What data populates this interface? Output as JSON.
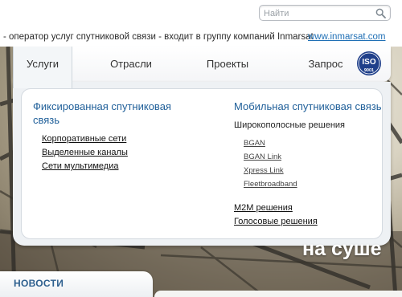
{
  "search": {
    "placeholder": "Найти"
  },
  "ticker": {
    "text": "- оператор услуг спутниковой связи - входит в группу компаний Inmarsat",
    "link": "www.inmarsat.com"
  },
  "nav": {
    "tabs": [
      "Услуги",
      "Отрасли",
      "Проекты",
      "Запрос"
    ],
    "active": "Услуги"
  },
  "badge": {
    "top": "ISO",
    "bottom": "9001"
  },
  "menu": {
    "fixed": {
      "title_line1": "Фиксированная спутниковая",
      "title_line2": "связь",
      "links": [
        "Корпоративные сети",
        "Выделенные каналы",
        "Сети мультимедиа"
      ]
    },
    "mobile": {
      "title": "Мобильная спутниковая связь",
      "broadband_heading": "Широкополосные решения",
      "broadband_links": [
        "BGAN",
        "BGAN Link",
        "Xpress Link",
        "Fleetbroadband"
      ],
      "links": [
        "M2M решения",
        "Голосовые решения"
      ]
    }
  },
  "hero": {
    "overlay": "на суше"
  },
  "news": {
    "label": "НОВОСТИ"
  },
  "colors": {
    "accent": "#1f5f99",
    "link": "#1f6fb5",
    "badge": "#1f3f8a"
  }
}
